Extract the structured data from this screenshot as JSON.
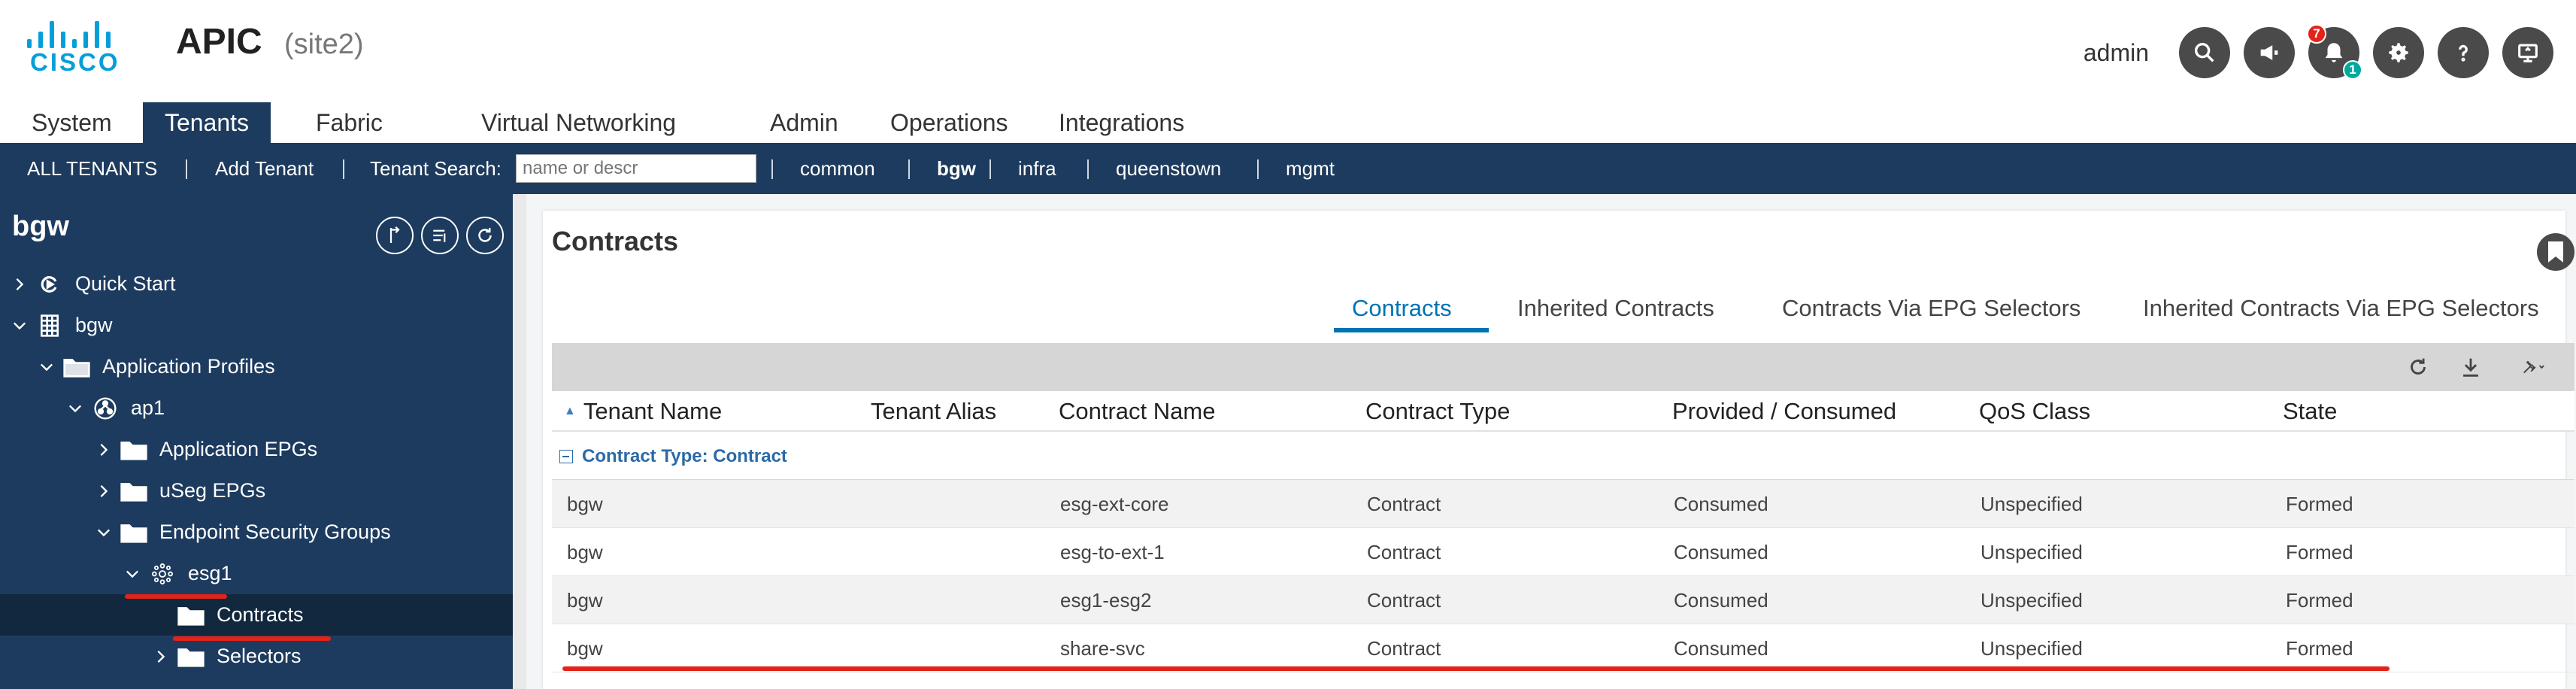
{
  "header": {
    "logo_text": "CISCO",
    "app_title": "APIC",
    "site": "(site2)",
    "username": "admin",
    "alerts": {
      "faults_count": "7",
      "notifications_count": "1"
    }
  },
  "menu": {
    "items": [
      "System",
      "Tenants",
      "Fabric",
      "Virtual Networking",
      "Admin",
      "Operations",
      "Integrations"
    ],
    "active": "Tenants"
  },
  "tenant_bar": {
    "all_tenants": "ALL TENANTS",
    "add_tenant": "Add Tenant",
    "search_label": "Tenant Search:",
    "search_placeholder": "name or descr",
    "tenants": [
      "common",
      "bgw",
      "infra",
      "queenstown",
      "mgmt"
    ],
    "active_tenant": "bgw"
  },
  "sidebar": {
    "title": "bgw",
    "tree": [
      {
        "label": "Quick Start",
        "icon": "quick-start-icon",
        "chevron": "right"
      },
      {
        "label": "bgw",
        "icon": "tenant-grid-icon",
        "chevron": "down"
      },
      {
        "label": "Application Profiles",
        "icon": "folder-icon",
        "chevron": "down"
      },
      {
        "label": "ap1",
        "icon": "app-profile-icon",
        "chevron": "down"
      },
      {
        "label": "Application EPGs",
        "icon": "folder-icon",
        "chevron": "right"
      },
      {
        "label": "uSeg EPGs",
        "icon": "folder-icon",
        "chevron": "right"
      },
      {
        "label": "Endpoint Security Groups",
        "icon": "folder-icon",
        "chevron": "down"
      },
      {
        "label": "esg1",
        "icon": "esg-icon",
        "chevron": "down"
      },
      {
        "label": "Contracts",
        "icon": "folder-icon",
        "chevron": "none"
      },
      {
        "label": "Selectors",
        "icon": "folder-icon",
        "chevron": "right"
      }
    ]
  },
  "main": {
    "title": "Contracts",
    "tabs": [
      "Contracts",
      "Inherited Contracts",
      "Contracts Via EPG Selectors",
      "Inherited Contracts Via EPG Selectors"
    ],
    "active_tab": "Contracts",
    "columns": [
      "Tenant Name",
      "Tenant Alias",
      "Contract Name",
      "Contract Type",
      "Provided / Consumed",
      "QoS Class",
      "State"
    ],
    "group_label": "Contract Type: Contract",
    "rows": [
      {
        "tenant": "bgw",
        "alias": "",
        "contract": "esg-ext-core",
        "type": "Contract",
        "provided_consumed": "Consumed",
        "qos": "Unspecified",
        "state": "Formed"
      },
      {
        "tenant": "bgw",
        "alias": "",
        "contract": "esg-to-ext-1",
        "type": "Contract",
        "provided_consumed": "Consumed",
        "qos": "Unspecified",
        "state": "Formed"
      },
      {
        "tenant": "bgw",
        "alias": "",
        "contract": "esg1-esg2",
        "type": "Contract",
        "provided_consumed": "Consumed",
        "qos": "Unspecified",
        "state": "Formed"
      },
      {
        "tenant": "bgw",
        "alias": "",
        "contract": "share-svc",
        "type": "Contract",
        "provided_consumed": "Consumed",
        "qos": "Unspecified",
        "state": "Formed"
      }
    ]
  },
  "colors": {
    "navy": "#1d3b5e",
    "accent_blue": "#0073b3",
    "annotation_red": "#e2231a",
    "cisco_blue": "#049fd9"
  }
}
